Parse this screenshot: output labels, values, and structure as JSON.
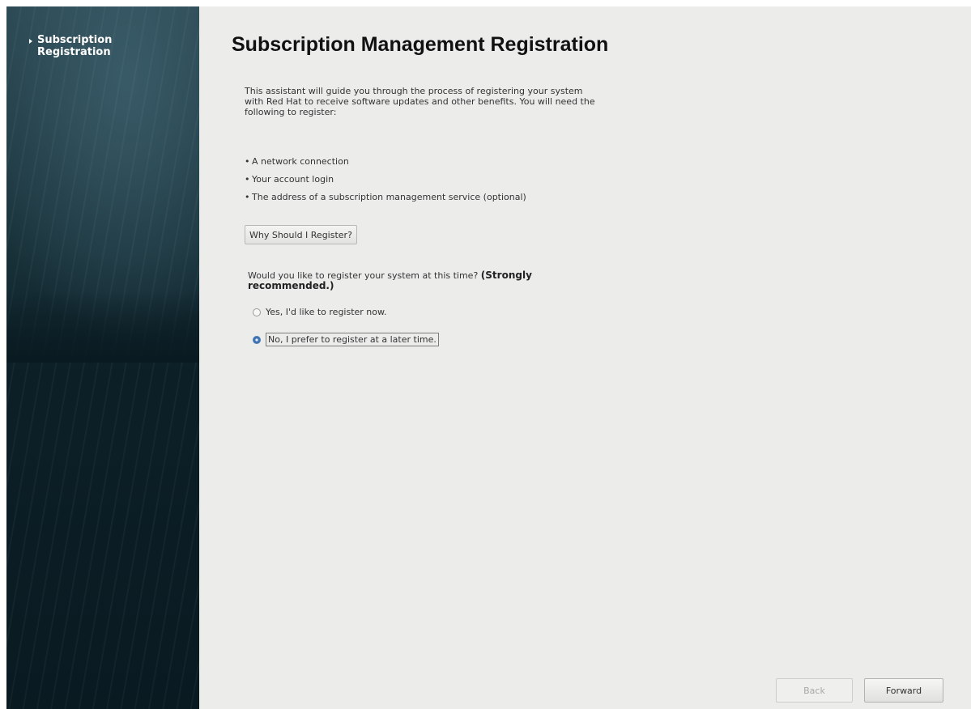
{
  "sidebar": {
    "steps": [
      {
        "label": "Subscription Registration",
        "active": true
      }
    ]
  },
  "main": {
    "title": "Subscription Management Registration",
    "intro": "This assistant will guide you through the process of registering your system with Red Hat to receive software updates and other benefits. You will need the following to register:",
    "requirements": [
      "A network connection",
      "Your account login",
      "The address of a subscription management service (optional)"
    ],
    "why_button": "Why Should I Register?",
    "question_text": "Would you like to register your system at this time?",
    "question_emphasis": "(Strongly recommended.)",
    "options": [
      {
        "label": "Yes, I'd like to register now.",
        "selected": false
      },
      {
        "label": "No, I prefer to register at a later time.",
        "selected": true
      }
    ]
  },
  "footer": {
    "back_label": "Back",
    "back_enabled": false,
    "forward_label": "Forward"
  },
  "colors": {
    "sidebar_dark": "#0a1a21",
    "content_bg": "#ececeb",
    "radio_selected": "#3a6db0"
  }
}
